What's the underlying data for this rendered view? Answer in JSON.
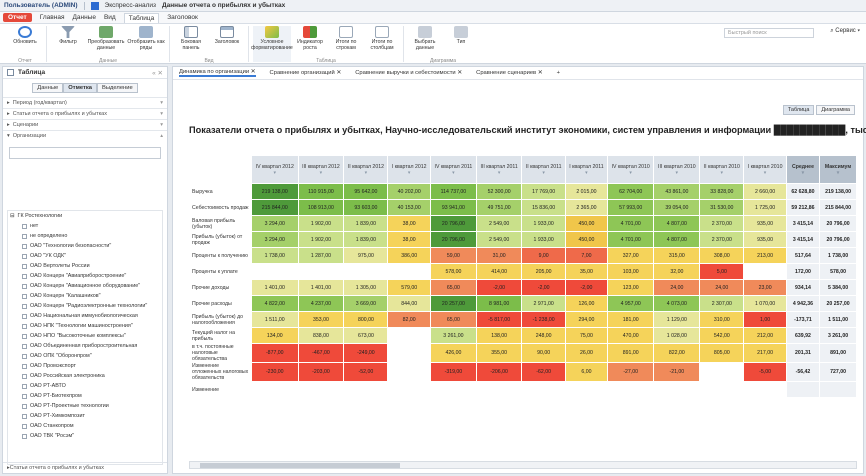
{
  "titlebar": {
    "user": "Пользователь (ADMIN)",
    "app": "Экспресс-анализ",
    "doc": "Данные отчета о прибылях и убытках"
  },
  "menubar": {
    "accent": "Отчет",
    "tabs": [
      "Главная",
      "Данные",
      "Вид",
      "Таблица",
      "Заголовок"
    ],
    "active": "Главная"
  },
  "ribbon": {
    "buttons": [
      "Обновить",
      "Фильтр",
      "Преобразовать данные",
      "Отобразить как ряды",
      "Боковая панель",
      "Заголовок",
      "Условное форматирование",
      "Индикатор роста",
      "Итоги по строкам",
      "Итоги по столбцам",
      "Выбрать данные",
      "Тип"
    ],
    "groups": [
      "Отчет",
      "Данные",
      "Вид",
      "Таблица",
      "Диаграмма"
    ],
    "search_placeholder": "Быстрый поиск",
    "service": "Сервис"
  },
  "leftpanel": {
    "title": "Таблица",
    "tabs": [
      "Данные",
      "Отметка",
      "Выделение"
    ],
    "accordions": [
      "Период (год/квартал)",
      "Статьи отчета о прибылях и убытках",
      "Сценарии",
      "Организации"
    ],
    "footer": "Статьи отчета о прибылях и убытках",
    "tree_root": "ГК Ростехнологии",
    "tree": [
      "нет",
      "не определено",
      "ОАО \"Технологии безопасности\"",
      "ОАО \"УК ОДК\"",
      "ОАО Вертолеты России",
      "ОАО Концерн \"Авиаприборостроение\"",
      "ОАО Концерн \"Авиационное оборудование\"",
      "ОАО Концерн \"Калашников\"",
      "ОАО Концерн \"Радиоэлектронные технологии\"",
      "ОАО Национальная иммунобиологическая",
      "ОАО НПК \"Технологии машиностроения\"",
      "ОАО НПО \"Высокоточные комплексы\"",
      "ОАО Объединенная приборостроительная",
      "ОАО ОПК \"Оборонпром\"",
      "ОАО Промэкспорт",
      "ОАО Российская электроника",
      "ОАО РТ-АВТО",
      "ОАО РТ-Биотехпром",
      "ОАО РТ-Проектные технологии",
      "ОАО РТ-Химкомпозит",
      "ОАО Станкопром",
      "ОАО ТВК \"Росэм\""
    ]
  },
  "doctabs": [
    "Динамика по организации",
    "Сравнение организаций",
    "Сравнение выручки и себестоимости",
    "Сравнение сценариев"
  ],
  "viewtoggle": [
    "Таблица",
    "Диаграмма"
  ],
  "report": {
    "title": "Показатели отчета о прибылях и убытках, Научно-исследовательский институт экономики, систем управления и информации ███████████, тыс. руб."
  },
  "columns": [
    "IV квартал 2012",
    "III квартал 2012",
    "II квартал 2012",
    "I квартал 2012",
    "IV квартал 2011",
    "III квартал 2011",
    "II квартал 2011",
    "I квартал 2011",
    "IV квартал 2010",
    "III квартал 2010",
    "II квартал 2010",
    "I квартал 2010",
    "Среднее",
    "Максимум"
  ],
  "rows": [
    {
      "label": "Выручка",
      "vals": [
        "219 138,00",
        "110 915,00",
        "95 642,00",
        "40 202,00",
        "114 737,00",
        "52 300,00",
        "17 769,00",
        "2 015,00",
        "62 704,00",
        "43 861,00",
        "33 828,00",
        "2 660,00",
        "62 628,80",
        "219 138,00"
      ],
      "cols": [
        "#4e9a3a",
        "#7cbd4a",
        "#7cbd4a",
        "#a5d06a",
        "#7cbd4a",
        "#a5d06a",
        "#c9e08a",
        "#e6e69a",
        "#8ec656",
        "#a5d06a",
        "#a5d06a",
        "#e6e69a"
      ]
    },
    {
      "label": "Себестоимость продаж",
      "vals": [
        "215 844,00",
        "108 913,00",
        "93 603,00",
        "40 153,00",
        "93 941,00",
        "49 751,00",
        "15 836,00",
        "2 365,00",
        "57 993,00",
        "39 054,00",
        "31 530,00",
        "1 725,00",
        "59 212,86",
        "215 844,00"
      ],
      "cols": [
        "#4e9a3a",
        "#7cbd4a",
        "#7cbd4a",
        "#a5d06a",
        "#7cbd4a",
        "#a5d06a",
        "#c9e08a",
        "#e6e69a",
        "#8ec656",
        "#a5d06a",
        "#a5d06a",
        "#e6e69a"
      ]
    },
    {
      "label": "Валовая прибыль (убыток)",
      "vals": [
        "3 294,00",
        "1 902,00",
        "1 839,00",
        "38,00",
        "20 796,00",
        "2 549,00",
        "1 933,00",
        "450,00",
        "4 701,00",
        "4 807,00",
        "2 370,00",
        "935,00",
        "3 415,14",
        "20 796,00"
      ],
      "cols": [
        "#a5d06a",
        "#c9e08a",
        "#c9e08a",
        "#f5d35a",
        "#4e9a3a",
        "#c9e08a",
        "#c9e08a",
        "#f0c64a",
        "#8ec656",
        "#8ec656",
        "#c9e08a",
        "#e6e69a"
      ]
    },
    {
      "label": "Прибыль (убыток) от продаж",
      "vals": [
        "3 294,00",
        "1 902,00",
        "1 839,00",
        "38,00",
        "20 796,00",
        "2 549,00",
        "1 933,00",
        "450,00",
        "4 701,00",
        "4 807,00",
        "2 370,00",
        "935,00",
        "3 415,14",
        "20 796,00"
      ],
      "cols": [
        "#a5d06a",
        "#c9e08a",
        "#c9e08a",
        "#f5d35a",
        "#4e9a3a",
        "#c9e08a",
        "#c9e08a",
        "#f0c64a",
        "#8ec656",
        "#8ec656",
        "#c9e08a",
        "#e6e69a"
      ]
    },
    {
      "label": "Проценты к получению",
      "vals": [
        "1 738,00",
        "1 287,00",
        "975,00",
        "386,00",
        "59,00",
        "31,00",
        "9,00",
        "7,00",
        "327,00",
        "315,00",
        "308,00",
        "213,00",
        "517,64",
        "1 738,00"
      ],
      "cols": [
        "#c9e08a",
        "#c9e08a",
        "#e6e69a",
        "#f5d35a",
        "#f08a5a",
        "#f08a5a",
        "#ef6a4a",
        "#ef6a4a",
        "#f5d35a",
        "#f5d35a",
        "#f5d35a",
        "#f5d35a"
      ]
    },
    {
      "label": "Проценты к уплате",
      "vals": [
        "",
        "",
        "",
        "",
        "578,00",
        "414,00",
        "205,00",
        "35,00",
        "103,00",
        "32,00",
        "5,00",
        "",
        "172,00",
        "578,00"
      ],
      "cols": [
        "#ffffff",
        "#ffffff",
        "#ffffff",
        "#ffffff",
        "#f5d35a",
        "#f5d35a",
        "#f5d35a",
        "#f5d35a",
        "#f5d35a",
        "#f5d35a",
        "#ef4a3a",
        "#ffffff"
      ]
    },
    {
      "label": "Прочие доходы",
      "vals": [
        "1 401,00",
        "1 401,00",
        "1 305,00",
        "579,00",
        "65,00",
        "-2,00",
        "-2,00",
        "-2,00",
        "123,00",
        "24,00",
        "24,00",
        "23,00",
        "934,14",
        "5 384,00"
      ],
      "cols": [
        "#e6e69a",
        "#e6e69a",
        "#e6e69a",
        "#f5d35a",
        "#f08a5a",
        "#ef4a3a",
        "#ef4a3a",
        "#ef4a3a",
        "#f5d35a",
        "#f08a5a",
        "#f08a5a",
        "#f08a5a"
      ]
    },
    {
      "label": "Прочие расходы",
      "vals": [
        "4 822,00",
        "4 237,00",
        "3 669,00",
        "844,00",
        "20 257,00",
        "8 981,00",
        "2 971,00",
        "126,00",
        "4 957,00",
        "4 073,00",
        "2 307,00",
        "1 070,00",
        "4 942,36",
        "20 257,00"
      ],
      "cols": [
        "#8ec656",
        "#8ec656",
        "#a5d06a",
        "#e6e69a",
        "#4e9a3a",
        "#7cbd4a",
        "#c9e08a",
        "#f5d35a",
        "#8ec656",
        "#8ec656",
        "#c9e08a",
        "#e6e69a"
      ]
    },
    {
      "label": "Прибыль (убыток) до налогообложения",
      "vals": [
        "1 511,00",
        "353,00",
        "800,00",
        "82,00",
        "65,00",
        "-5 817,00",
        "-1 238,00",
        "294,00",
        "181,00",
        "1 129,00",
        "310,00",
        "1,00",
        "-173,71",
        "1 511,00"
      ],
      "cols": [
        "#e6e69a",
        "#f5d35a",
        "#f5d35a",
        "#f08a5a",
        "#f08a5a",
        "#ef4a3a",
        "#ef4a3a",
        "#f5d35a",
        "#f5d35a",
        "#e6e69a",
        "#f5d35a",
        "#ef4a3a"
      ]
    },
    {
      "label": "Текущий налог на прибыль",
      "vals": [
        "134,00",
        "838,00",
        "673,00",
        "",
        "3 261,00",
        "138,00",
        "248,00",
        "75,00",
        "470,00",
        "1 028,00",
        "542,00",
        "212,00",
        "639,92",
        "3 261,00"
      ],
      "cols": [
        "#f5d35a",
        "#e6e69a",
        "#e6e69a",
        "#ffffff",
        "#c9e08a",
        "#f5d35a",
        "#f5d35a",
        "#f5d35a",
        "#f5d35a",
        "#e6e69a",
        "#f5d35a",
        "#f5d35a"
      ]
    },
    {
      "label": "в т.ч. постоянные налоговые обязательства",
      "vals": [
        "-877,00",
        "-467,00",
        "-249,00",
        "",
        "426,00",
        "355,00",
        "90,00",
        "26,00",
        "891,00",
        "822,00",
        "805,00",
        "217,00",
        "201,31",
        "891,00"
      ],
      "cols": [
        "#ef4a3a",
        "#ef4a3a",
        "#ef4a3a",
        "#ffffff",
        "#f5d35a",
        "#f5d35a",
        "#f5d35a",
        "#f5d35a",
        "#f5d35a",
        "#f5d35a",
        "#f5d35a",
        "#f5d35a"
      ]
    },
    {
      "label": "Изменение отложенных налоговых обязательств",
      "vals": [
        "-230,00",
        "-203,00",
        "-52,00",
        "",
        "-319,00",
        "-206,00",
        "-62,00",
        "6,00",
        "-27,00",
        "-21,00",
        "",
        "-5,00",
        "-56,42",
        "727,00"
      ],
      "cols": [
        "#ef4a3a",
        "#ef4a3a",
        "#ef4a3a",
        "#ffffff",
        "#ef4a3a",
        "#ef4a3a",
        "#ef4a3a",
        "#f5d35a",
        "#f08a5a",
        "#f08a5a",
        "#ffffff",
        "#ef4a3a"
      ]
    },
    {
      "label": "Изменение",
      "vals": [
        "",
        "",
        "",
        "",
        "",
        "",
        "",
        "",
        "",
        "",
        "",
        "",
        "",
        ""
      ],
      "cols": [
        "#ffffff",
        "#ffffff",
        "#ffffff",
        "#ffffff",
        "#ffffff",
        "#ffffff",
        "#ffffff",
        "#ffffff",
        "#ffffff",
        "#ffffff",
        "#ffffff",
        "#ffffff"
      ]
    }
  ]
}
